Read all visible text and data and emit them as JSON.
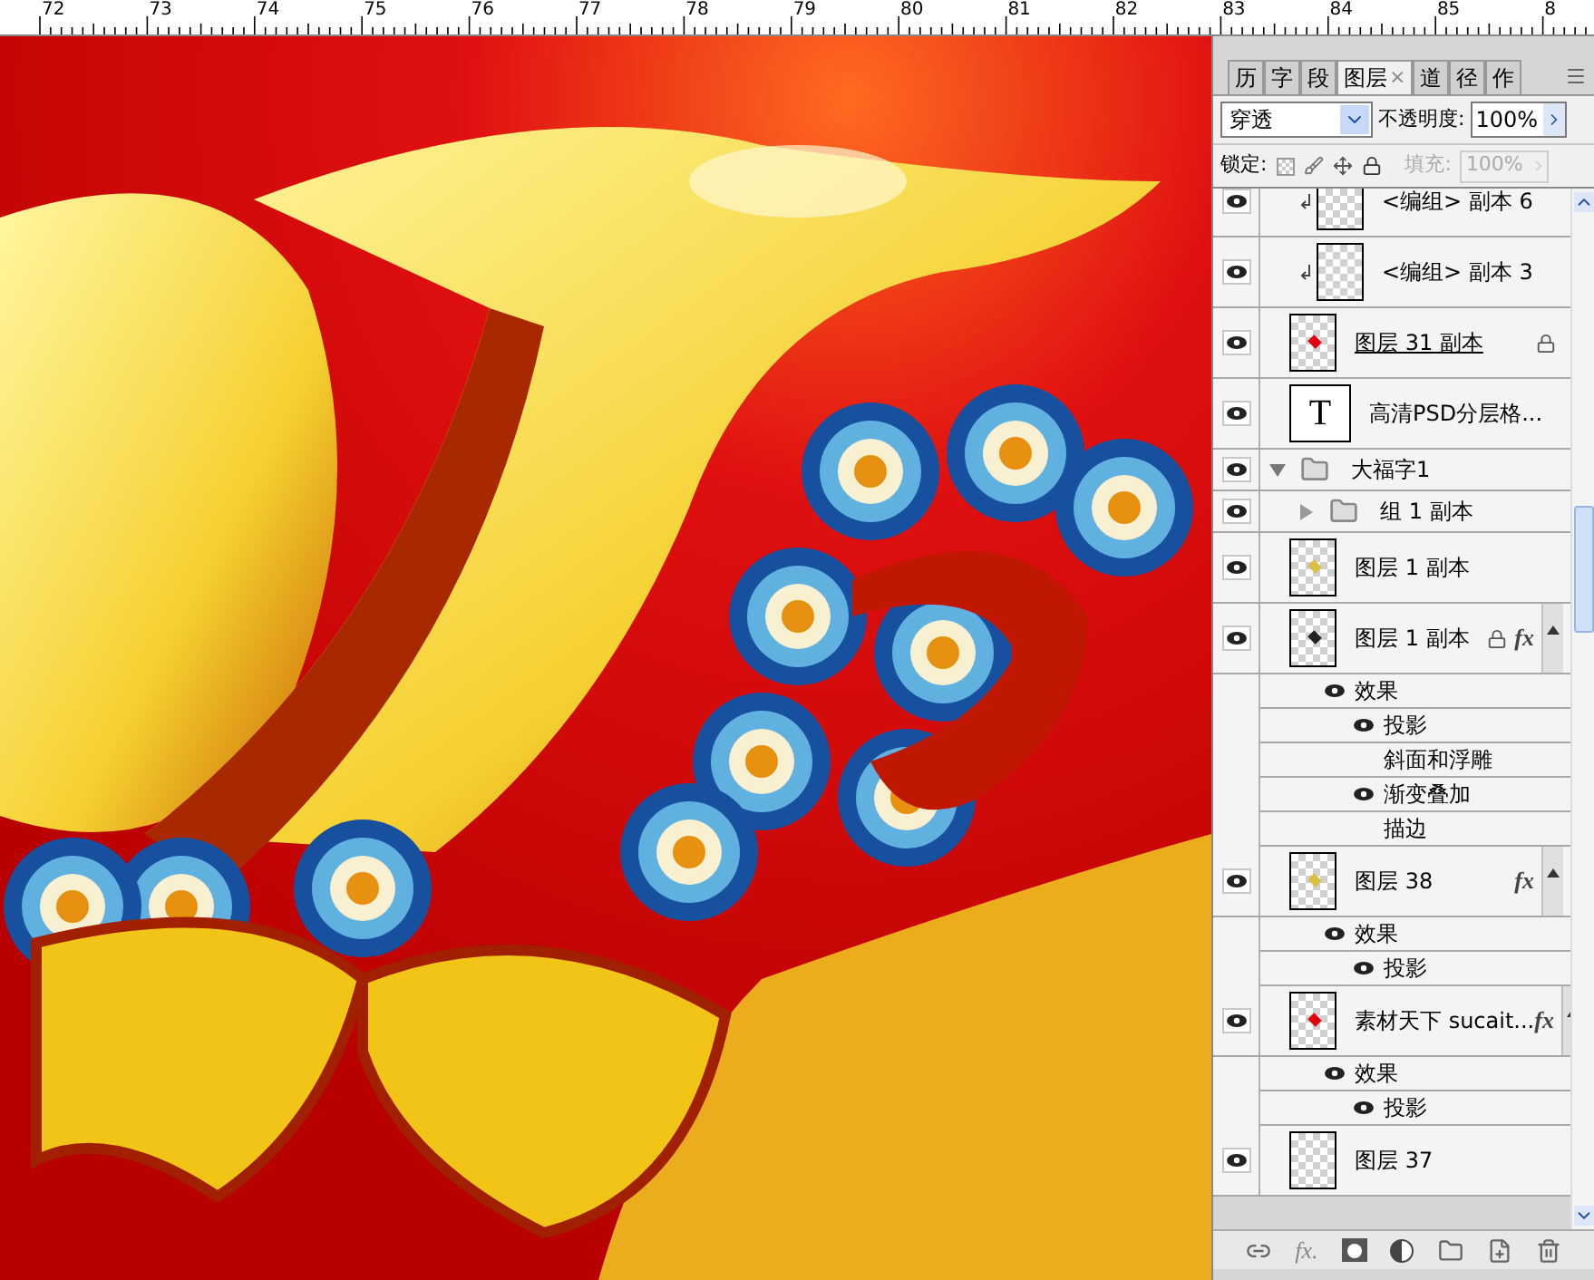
{
  "ruler": {
    "labels": [
      "72",
      "73",
      "74",
      "75",
      "76",
      "77",
      "78",
      "79",
      "80",
      "81",
      "82",
      "83",
      "84",
      "85",
      "8"
    ]
  },
  "panel": {
    "tabs": [
      {
        "label": "历",
        "selected": false
      },
      {
        "label": "字",
        "selected": false
      },
      {
        "label": "段",
        "selected": false
      },
      {
        "label": "图层",
        "selected": true,
        "close": "×"
      },
      {
        "label": "道",
        "selected": false
      },
      {
        "label": "径",
        "selected": false
      },
      {
        "label": "作",
        "selected": false
      }
    ],
    "blend_mode": "穿透",
    "opacity_label": "不透明度:",
    "opacity": "100%",
    "lock_label": "锁定:",
    "fill_label": "填充:",
    "fill": "100%",
    "fill_disabled": true,
    "layers": [
      {
        "kind": "layer",
        "name": "<编组> 副本 6",
        "visible": true,
        "clipped": true
      },
      {
        "kind": "layer",
        "name": "<编组> 副本 3",
        "visible": true,
        "clipped": true
      },
      {
        "kind": "layer",
        "name": "图层 31 副本",
        "visible": true,
        "underlined": true,
        "locked": true,
        "color": "#e00010"
      },
      {
        "kind": "text",
        "name": "高清PSD分层格...",
        "visible": true,
        "thumb_label": "T"
      },
      {
        "kind": "group",
        "name": "大福字1",
        "visible": true,
        "expanded": true,
        "children": [
          {
            "kind": "group",
            "name": "组 1 副本",
            "visible": true,
            "expanded": false
          },
          {
            "kind": "layer",
            "name": "图层 1 副本",
            "visible": true,
            "color": "#d8c040"
          },
          {
            "kind": "layer",
            "name": "图层 1 副本",
            "visible": true,
            "locked": true,
            "fx": "fx",
            "color": "#222222",
            "effects": {
              "label": "效果",
              "visible": true,
              "items": [
                {
                  "name": "投影",
                  "visible": true
                },
                {
                  "name": "斜面和浮雕",
                  "visible": false
                },
                {
                  "name": "渐变叠加",
                  "visible": true
                },
                {
                  "name": "描边",
                  "visible": false
                }
              ]
            }
          },
          {
            "kind": "layer",
            "name": "图层 38",
            "visible": true,
            "fx": "fx",
            "color": "#d8c040",
            "effects": {
              "label": "效果",
              "visible": true,
              "items": [
                {
                  "name": "投影",
                  "visible": true
                }
              ]
            }
          },
          {
            "kind": "layer",
            "name": "素材天下 sucait...",
            "visible": true,
            "fx": "fx",
            "color": "#e00010",
            "effects": {
              "label": "效果",
              "visible": true,
              "items": [
                {
                  "name": "投影",
                  "visible": true
                }
              ]
            }
          },
          {
            "kind": "layer",
            "name": "图层 37",
            "visible": true
          }
        ]
      }
    ],
    "toolbar": [
      {
        "kind": "link"
      },
      {
        "kind": "fx",
        "label": "fx."
      },
      {
        "kind": "mask"
      },
      {
        "kind": "adjust"
      },
      {
        "kind": "folder"
      },
      {
        "kind": "new"
      },
      {
        "kind": "trash"
      }
    ]
  }
}
